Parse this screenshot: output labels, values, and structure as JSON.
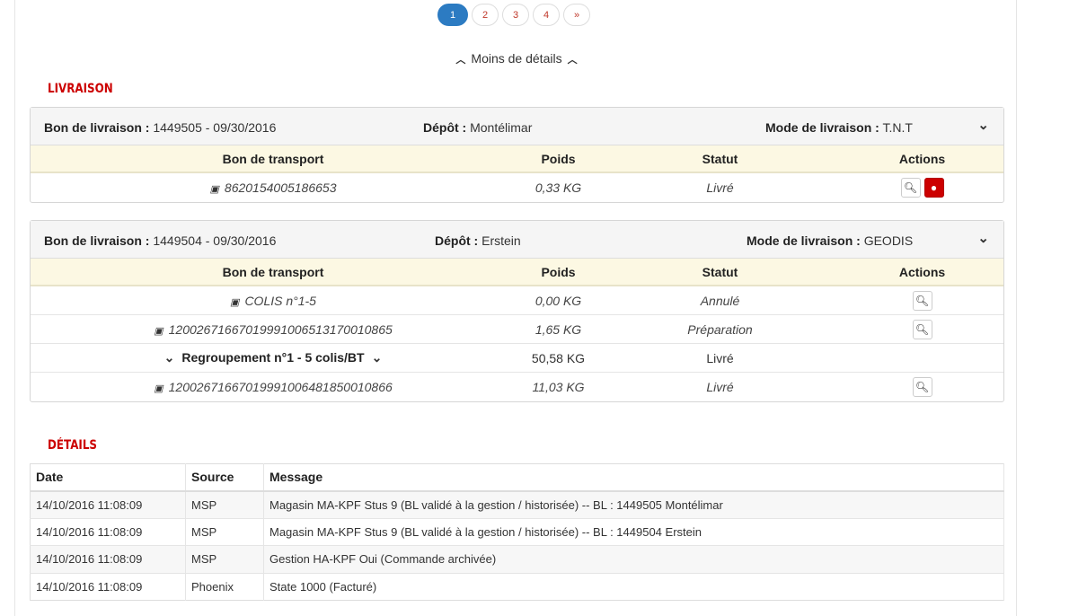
{
  "pagination": {
    "pages": [
      "1",
      "2",
      "3",
      "4",
      "»"
    ],
    "active": "1"
  },
  "toggle_label": "Moins de détails",
  "livraison": {
    "title": "LIVRAISON",
    "labels": {
      "bon_livraison": "Bon de livraison :",
      "depot": "Dépôt :",
      "mode": "Mode de livraison :"
    },
    "columns": [
      "Bon de transport",
      "Poids",
      "Statut",
      "Actions"
    ],
    "panels": [
      {
        "bon": "1449505 - 09/30/2016",
        "depot": "Montélimar",
        "mode": "T.N.T",
        "rows": [
          {
            "transport": "8620154005186653",
            "poids": "0,33 KG",
            "statut": "Livré"
          }
        ]
      },
      {
        "bon": "1449504 - 09/30/2016",
        "depot": "Erstein",
        "mode": "GEODIS",
        "rows": [
          {
            "transport": "COLIS n°1-5",
            "poids": "0,00 KG",
            "statut": "Annulé"
          },
          {
            "transport": "12002671667019991006513170010865",
            "poids": "1,65 KG",
            "statut": "Préparation"
          },
          {
            "group": "Regroupement n°1 - 5 colis/BT",
            "poids": "50,58 KG",
            "statut": "Livré"
          },
          {
            "transport": "12002671667019991006481850010866",
            "poids": "11,03 KG",
            "statut": "Livré"
          }
        ]
      }
    ]
  },
  "details": {
    "title": "DÉTAILS",
    "columns": [
      "Date",
      "Source",
      "Message"
    ],
    "rows": [
      {
        "date": "14/10/2016 11:08:09",
        "source": "MSP",
        "message": "Magasin MA-KPF Stus 9 (BL validé à la gestion / historisée) -- BL : 1449505 Montélimar"
      },
      {
        "date": "14/10/2016 11:08:09",
        "source": "MSP",
        "message": "Magasin MA-KPF Stus 9 (BL validé à la gestion / historisée) -- BL : 1449504 Erstein"
      },
      {
        "date": "14/10/2016 11:08:09",
        "source": "MSP",
        "message": "Gestion HA-KPF Oui (Commande archivée)"
      },
      {
        "date": "14/10/2016 11:08:09",
        "source": "Phoenix",
        "message": "State 1000 (Facturé)"
      }
    ]
  },
  "icons": {
    "package": "package-icon",
    "search": "search-icon",
    "globe": "globe-icon",
    "chevron": "chevron-down-icon"
  },
  "colors": {
    "accent_red": "#cc0000",
    "pagination_active": "#2c7bc2",
    "table_header_bg": "#fcf8e3"
  }
}
